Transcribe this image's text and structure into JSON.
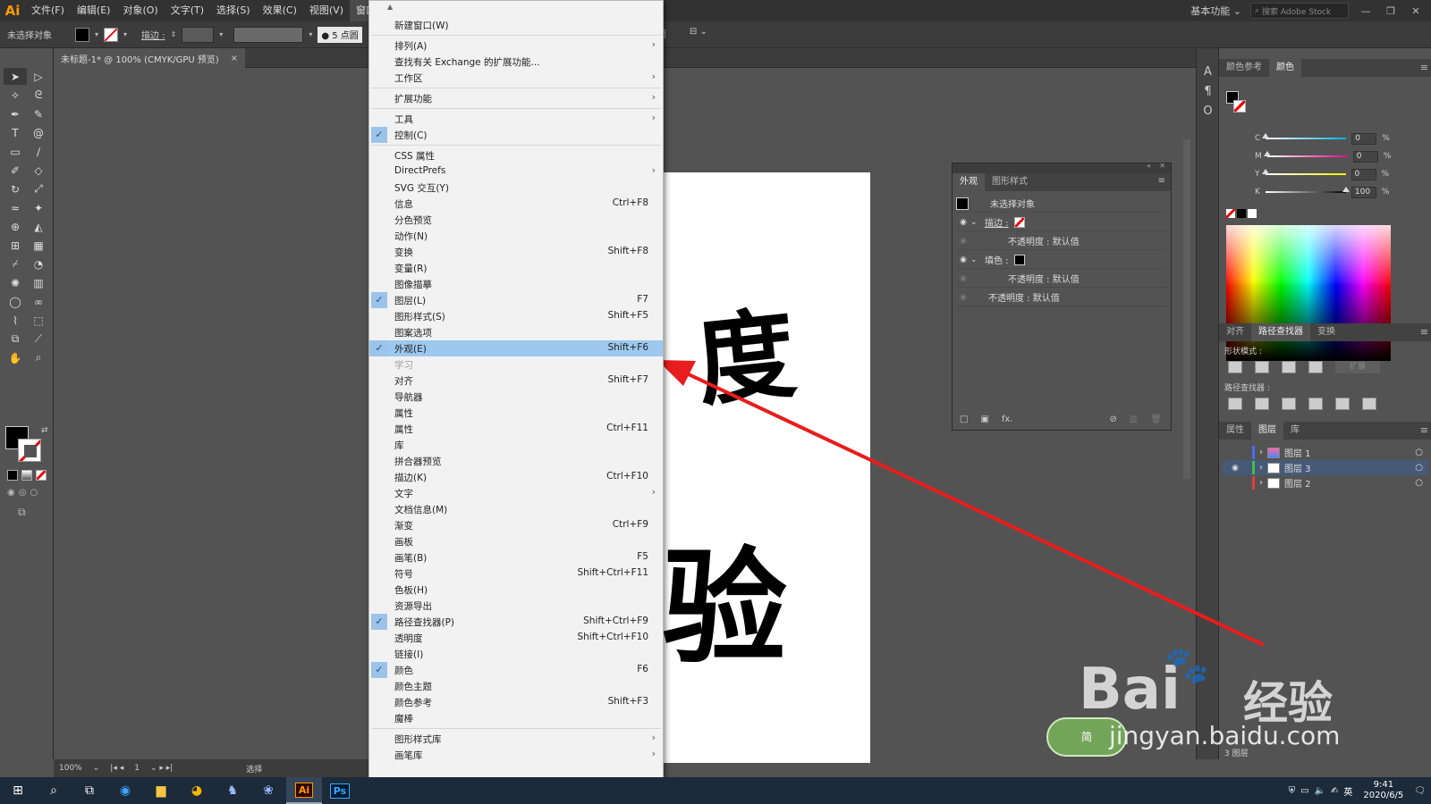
{
  "app": {
    "logo": "Ai",
    "menus": [
      "文件(F)",
      "编辑(E)",
      "对象(O)",
      "文字(T)",
      "选择(S)",
      "效果(C)",
      "视图(V)",
      "窗口(W)"
    ],
    "workspace": "基本功能",
    "stock_search_placeholder": "搜索 Adobe Stock"
  },
  "control_bar": {
    "selection_label": "未选择对象",
    "stroke_label": "描边 :",
    "brush_size": "● 5 点圆",
    "right_items": [
      "项",
      "扩"
    ]
  },
  "document": {
    "tab_title": "未标题-1* @ 100% (CMYK/GPU 预览)",
    "close": "×",
    "artboard_chars": [
      "度",
      "验"
    ]
  },
  "status_bar": {
    "zoom": "100%",
    "artboard_num": "1",
    "mode": "选择"
  },
  "window_menu": {
    "items": [
      {
        "label": "新建窗口(W)",
        "shortcut": "",
        "checked": false,
        "submenu": false
      },
      {
        "sep": true
      },
      {
        "label": "排列(A)",
        "shortcut": "",
        "checked": false,
        "submenu": true
      },
      {
        "label": "查找有关 Exchange 的扩展功能...",
        "shortcut": "",
        "checked": false,
        "submenu": false
      },
      {
        "label": "工作区",
        "shortcut": "",
        "checked": false,
        "submenu": true
      },
      {
        "sep": true
      },
      {
        "label": "扩展功能",
        "shortcut": "",
        "checked": false,
        "submenu": true
      },
      {
        "sep": true
      },
      {
        "label": "工具",
        "shortcut": "",
        "checked": false,
        "submenu": true
      },
      {
        "label": "控制(C)",
        "shortcut": "",
        "checked": true,
        "submenu": false
      },
      {
        "sep": true
      },
      {
        "label": "CSS 属性",
        "shortcut": "",
        "checked": false,
        "submenu": false
      },
      {
        "label": "DirectPrefs",
        "shortcut": "",
        "checked": false,
        "submenu": true
      },
      {
        "label": "SVG 交互(Y)",
        "shortcut": "",
        "checked": false,
        "submenu": false
      },
      {
        "label": "信息",
        "shortcut": "Ctrl+F8",
        "checked": false,
        "submenu": false
      },
      {
        "label": "分色预览",
        "shortcut": "",
        "checked": false,
        "submenu": false
      },
      {
        "label": "动作(N)",
        "shortcut": "",
        "checked": false,
        "submenu": false
      },
      {
        "label": "变换",
        "shortcut": "Shift+F8",
        "checked": false,
        "submenu": false
      },
      {
        "label": "变量(R)",
        "shortcut": "",
        "checked": false,
        "submenu": false
      },
      {
        "label": "图像描摹",
        "shortcut": "",
        "checked": false,
        "submenu": false
      },
      {
        "label": "图层(L)",
        "shortcut": "F7",
        "checked": true,
        "submenu": false
      },
      {
        "label": "图形样式(S)",
        "shortcut": "Shift+F5",
        "checked": false,
        "submenu": false
      },
      {
        "label": "图案选项",
        "shortcut": "",
        "checked": false,
        "submenu": false
      },
      {
        "label": "外观(E)",
        "shortcut": "Shift+F6",
        "checked": true,
        "submenu": false,
        "highlight": true
      },
      {
        "label": "学习",
        "shortcut": "",
        "checked": false,
        "submenu": false,
        "disabled": true
      },
      {
        "label": "对齐",
        "shortcut": "Shift+F7",
        "checked": false,
        "submenu": false
      },
      {
        "label": "导航器",
        "shortcut": "",
        "checked": false,
        "submenu": false
      },
      {
        "label": "属性",
        "shortcut": "",
        "checked": false,
        "submenu": false
      },
      {
        "label": "属性",
        "shortcut": "Ctrl+F11",
        "checked": false,
        "submenu": false
      },
      {
        "label": "库",
        "shortcut": "",
        "checked": false,
        "submenu": false
      },
      {
        "label": "拼合器预览",
        "shortcut": "",
        "checked": false,
        "submenu": false
      },
      {
        "label": "描边(K)",
        "shortcut": "Ctrl+F10",
        "checked": false,
        "submenu": false
      },
      {
        "label": "文字",
        "shortcut": "",
        "checked": false,
        "submenu": true
      },
      {
        "label": "文档信息(M)",
        "shortcut": "",
        "checked": false,
        "submenu": false
      },
      {
        "label": "渐变",
        "shortcut": "Ctrl+F9",
        "checked": false,
        "submenu": false
      },
      {
        "label": "画板",
        "shortcut": "",
        "checked": false,
        "submenu": false
      },
      {
        "label": "画笔(B)",
        "shortcut": "F5",
        "checked": false,
        "submenu": false
      },
      {
        "label": "符号",
        "shortcut": "Shift+Ctrl+F11",
        "checked": false,
        "submenu": false
      },
      {
        "label": "色板(H)",
        "shortcut": "",
        "checked": false,
        "submenu": false
      },
      {
        "label": "资源导出",
        "shortcut": "",
        "checked": false,
        "submenu": false
      },
      {
        "label": "路径查找器(P)",
        "shortcut": "Shift+Ctrl+F9",
        "checked": true,
        "submenu": false
      },
      {
        "label": "透明度",
        "shortcut": "Shift+Ctrl+F10",
        "checked": false,
        "submenu": false
      },
      {
        "label": "链接(I)",
        "shortcut": "",
        "checked": false,
        "submenu": false
      },
      {
        "label": "颜色",
        "shortcut": "F6",
        "checked": true,
        "submenu": false
      },
      {
        "label": "颜色主题",
        "shortcut": "",
        "checked": false,
        "submenu": false
      },
      {
        "label": "颜色参考",
        "shortcut": "Shift+F3",
        "checked": false,
        "submenu": false
      },
      {
        "label": "魔棒",
        "shortcut": "",
        "checked": false,
        "submenu": false
      },
      {
        "sep": true
      },
      {
        "label": "图形样式库",
        "shortcut": "",
        "checked": false,
        "submenu": true
      },
      {
        "label": "画笔库",
        "shortcut": "",
        "checked": false,
        "submenu": true
      }
    ]
  },
  "appearance_panel": {
    "tabs": [
      "外观",
      "图形样式"
    ],
    "title": "未选择对象",
    "rows": [
      "描边 :",
      "不透明度 : 默认值",
      "填色 :",
      "不透明度 : 默认值",
      "不透明度 : 默认值"
    ],
    "fx": "fx."
  },
  "color_panel": {
    "tabs": [
      "颜色参考",
      "颜色"
    ],
    "channels": [
      {
        "name": "C",
        "value": "0"
      },
      {
        "name": "M",
        "value": "0"
      },
      {
        "name": "Y",
        "value": "0"
      },
      {
        "name": "K",
        "value": "100"
      }
    ],
    "unit": "%"
  },
  "pathfinder_panel": {
    "tabs": [
      "对齐",
      "路径查找器",
      "变换"
    ],
    "shape_modes": "形状模式 :",
    "expand": "扩展",
    "pathfinders": "路径查找器 :"
  },
  "layers_panel": {
    "tabs": [
      "属性",
      "图层",
      "库"
    ],
    "layers": [
      {
        "name": "图层 1",
        "color": "#4b6cf0",
        "visible": false,
        "active": false
      },
      {
        "name": "图层 3",
        "color": "#3fbf3f",
        "visible": true,
        "active": true
      },
      {
        "name": "图层 2",
        "color": "#e04040",
        "visible": false,
        "active": false
      }
    ],
    "footer_count": "3 图层"
  },
  "taskbar": {
    "time": "9:41",
    "date": "2020/6/5",
    "ime": "英",
    "ime_mode": "简"
  },
  "watermark": {
    "brand": "Bai",
    "brand2": "经验",
    "url": "jingyan.baidu.com"
  },
  "colors": {
    "menu_highlight": "#9dc8ef",
    "arrow": "#e81d1d",
    "ui_dark": "#323232",
    "ui_mid": "#535353"
  }
}
